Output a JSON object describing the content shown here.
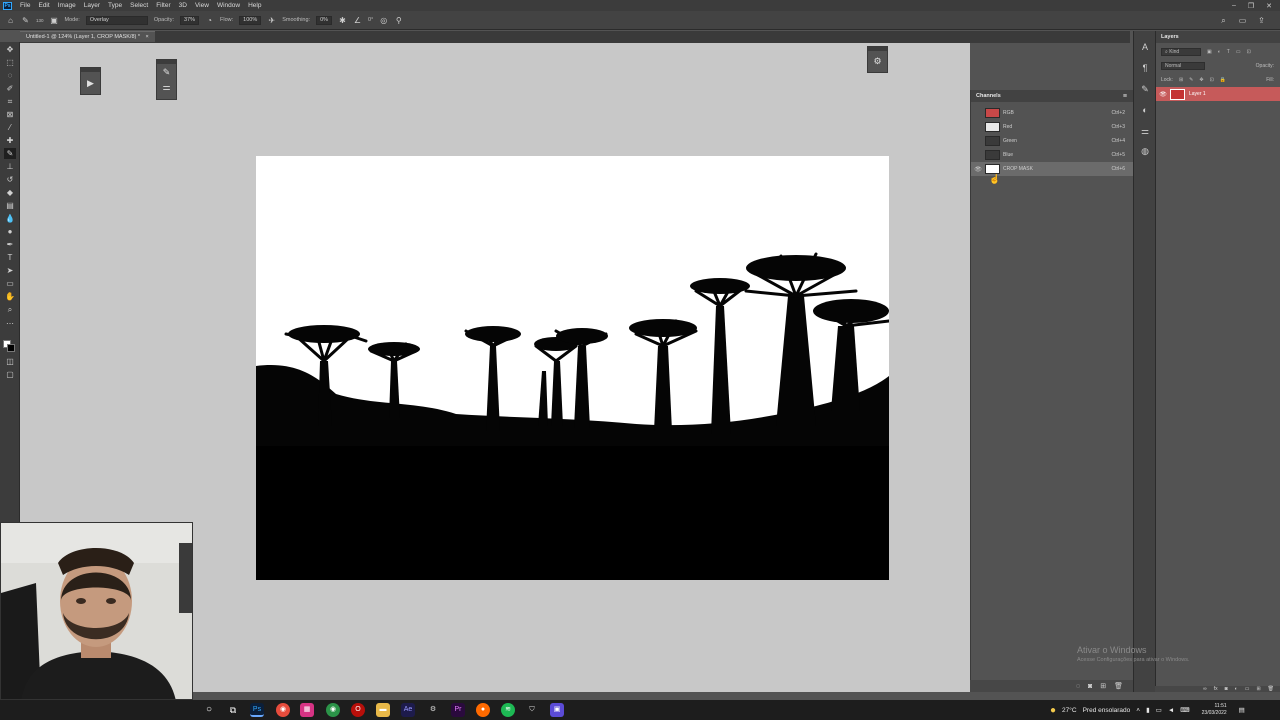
{
  "app": {
    "menu": [
      "File",
      "Edit",
      "Image",
      "Layer",
      "Type",
      "Select",
      "Filter",
      "3D",
      "View",
      "Window",
      "Help"
    ],
    "window_controls": [
      "–",
      "❐",
      "✕"
    ]
  },
  "options_bar": {
    "brush_size": "130",
    "mode_label": "Mode:",
    "mode_value": "Overlay",
    "opacity_label": "Opacity:",
    "opacity_value": "37%",
    "flow_label": "Flow:",
    "flow_value": "100%",
    "smoothing_label": "Smoothing:",
    "smoothing_value": "0%",
    "angle_value": "0°"
  },
  "document": {
    "tab_title": "Untitled-1 @ 124% (Layer 1, CROP MASK/8) *"
  },
  "channels_panel": {
    "title": "Channels",
    "channels": [
      {
        "name": "RGB",
        "shortcut": "Ctrl+2",
        "thumb": "#c84848"
      },
      {
        "name": "Red",
        "shortcut": "Ctrl+3",
        "thumb": "#e8e8e8"
      },
      {
        "name": "Green",
        "shortcut": "Ctrl+4",
        "thumb": "#3a3a3a"
      },
      {
        "name": "Blue",
        "shortcut": "Ctrl+5",
        "thumb": "#3a3a3a"
      },
      {
        "name": "CROP MASK",
        "shortcut": "Ctrl+6",
        "thumb": "#ffffff"
      }
    ]
  },
  "layers_panel": {
    "title": "Layers",
    "kind_label": "Kind",
    "blend_mode": "Normal",
    "opacity_label": "Opacity:",
    "lock_label": "Lock:",
    "fill_label": "Fill:",
    "layer_name": "Layer 1"
  },
  "watermark": {
    "title": "Ativar o Windows",
    "subtitle": "Acesse Configurações para ativar o Windows."
  },
  "taskbar": {
    "weather_temp": "27°C",
    "weather_desc": "Pred ensolarado",
    "time": "11:51",
    "date": "23/03/2022"
  }
}
